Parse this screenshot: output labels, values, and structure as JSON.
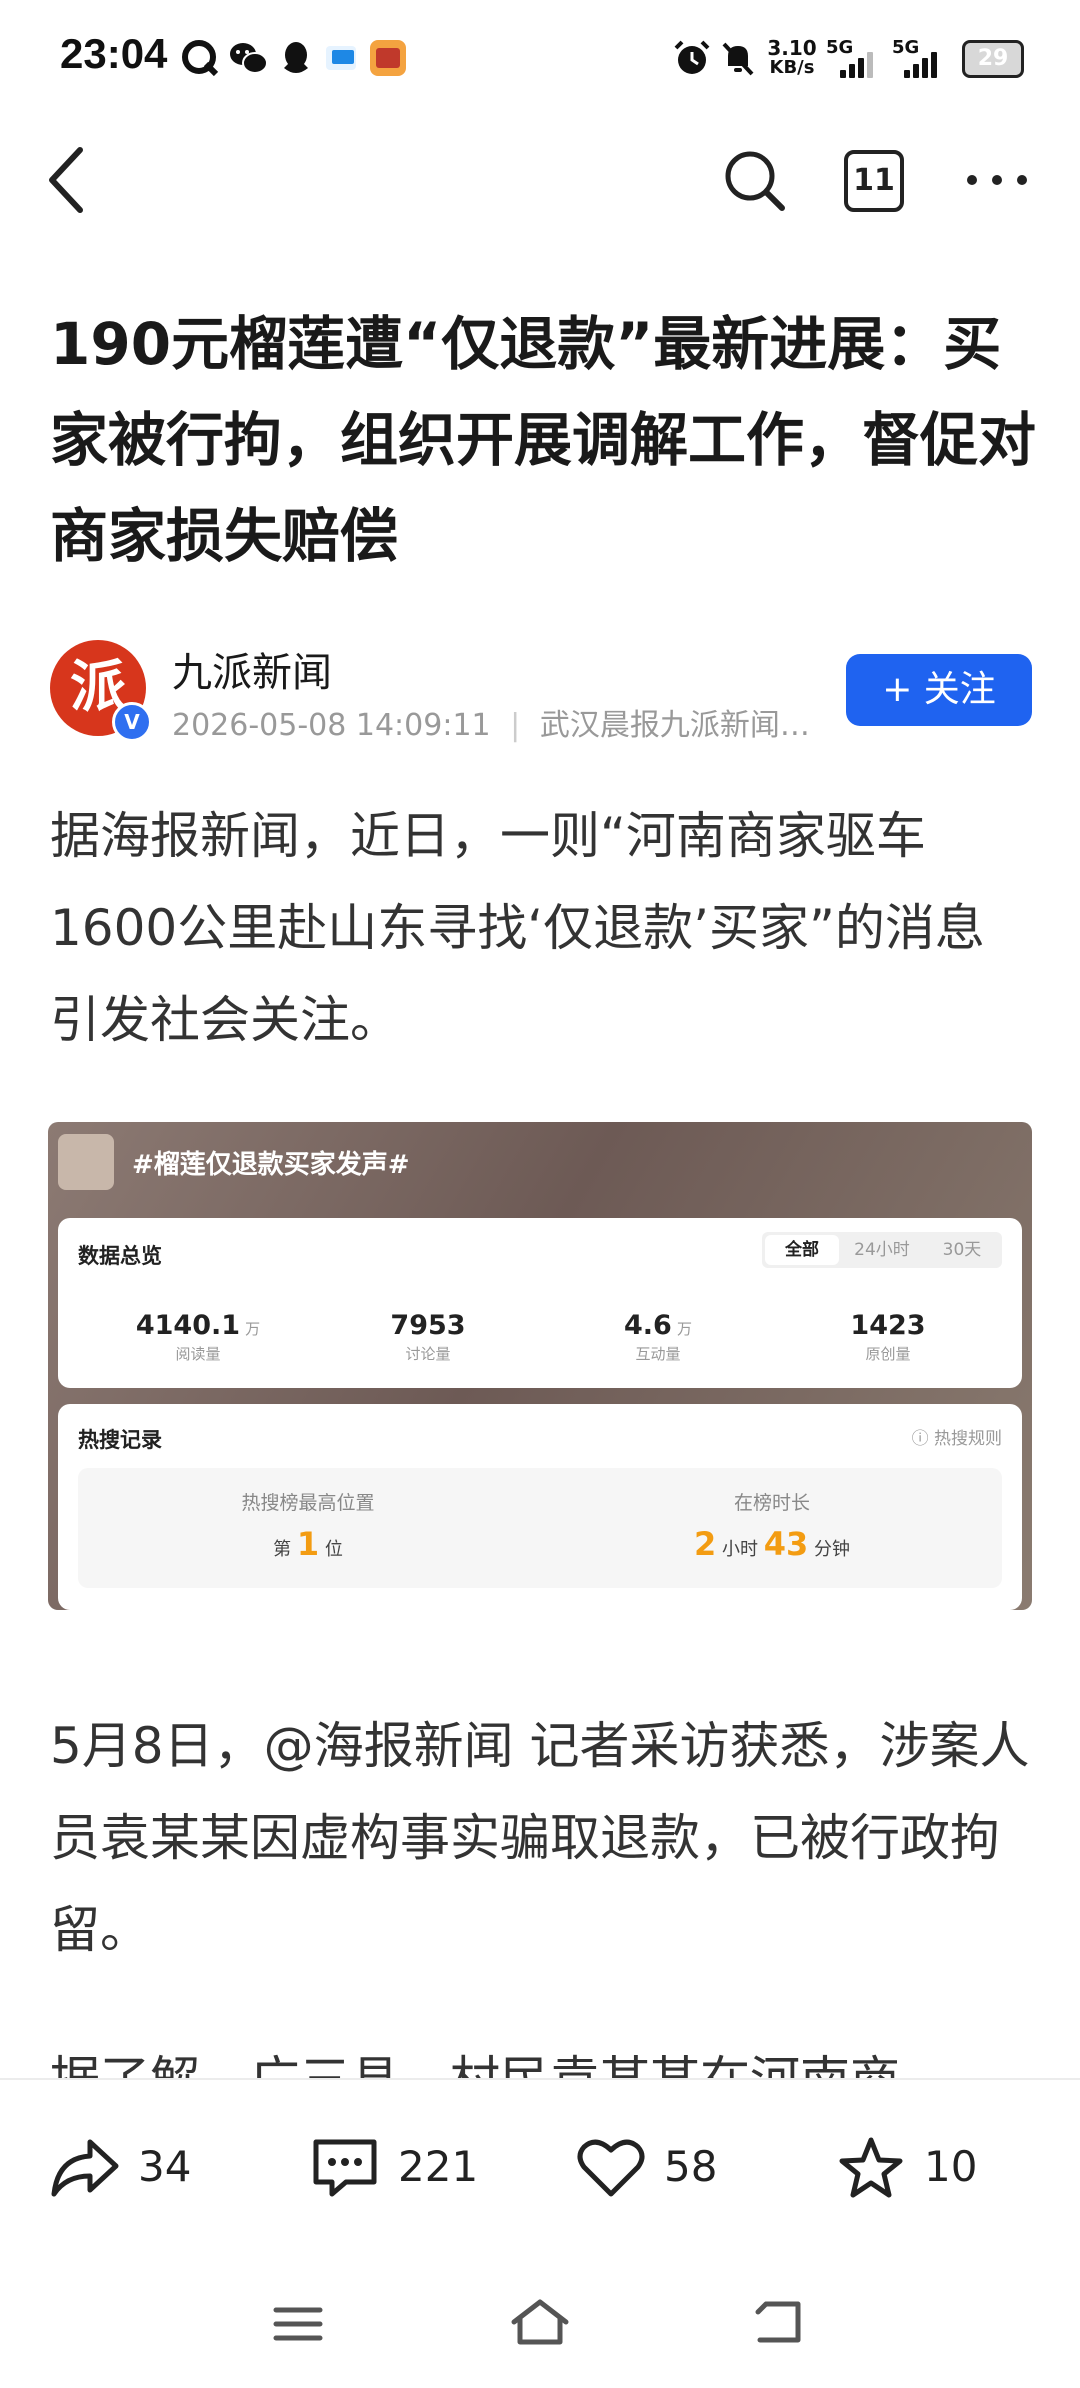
{
  "status_bar": {
    "time": "23:04",
    "net_speed_value": "3.10",
    "net_speed_unit": "KB/s",
    "signal1_label": "5G",
    "signal2_label": "5G",
    "battery": "29",
    "icons": [
      "q-icon",
      "wechat-icon",
      "qq-icon",
      "app-icon",
      "game-icon",
      "alarm-icon",
      "mute-icon"
    ]
  },
  "nav": {
    "tab_count": "11"
  },
  "article": {
    "title": "190元榴莲遭“仅退款”最新进展：买家被行拘，组织开展调解工作，督促对商家损失赔偿",
    "author": {
      "name": "九派新闻",
      "avatar_text": "派",
      "datetime": "2026-05-08 14:09:11",
      "source": "武汉晨报九派新闻…",
      "follow_label": "+ 关注"
    },
    "paragraphs": [
      "据海报新闻，近日，一则“河南商家驱车1600公里赴山东寻找‘仅退款’买家”的消息引发社会关注。",
      "5月8日，@海报新闻 记者采访获悉，涉案人员袁某某因虚构事实骗取退款，已被行政拘留。",
      "据了解，广三县，村民袁某某在河南商"
    ],
    "image": {
      "hashtag": "#榴莲仅退款买家发声#",
      "overview_title": "数据总览",
      "ranges": [
        "全部",
        "24小时",
        "30天"
      ],
      "stats": [
        {
          "value": "4140.1",
          "unit": "万",
          "label": "阅读量"
        },
        {
          "value": "7953",
          "unit": "",
          "label": "讨论量"
        },
        {
          "value": "4.6",
          "unit": "万",
          "label": "互动量"
        },
        {
          "value": "1423",
          "unit": "",
          "label": "原创量"
        }
      ],
      "hot_title": "热搜记录",
      "hot_rule": "ⓘ 热搜规则",
      "peak_label": "热搜榜最高位置",
      "peak_prefix": "第",
      "peak_value": "1",
      "peak_suffix": "位",
      "duration_label": "在榜时长",
      "duration_hours": "2",
      "duration_hours_unit": "小时",
      "duration_minutes": "43",
      "duration_minutes_unit": "分钟"
    }
  },
  "actions": {
    "share_count": "34",
    "comment_count": "221",
    "like_count": "58",
    "favorite_count": "10"
  }
}
